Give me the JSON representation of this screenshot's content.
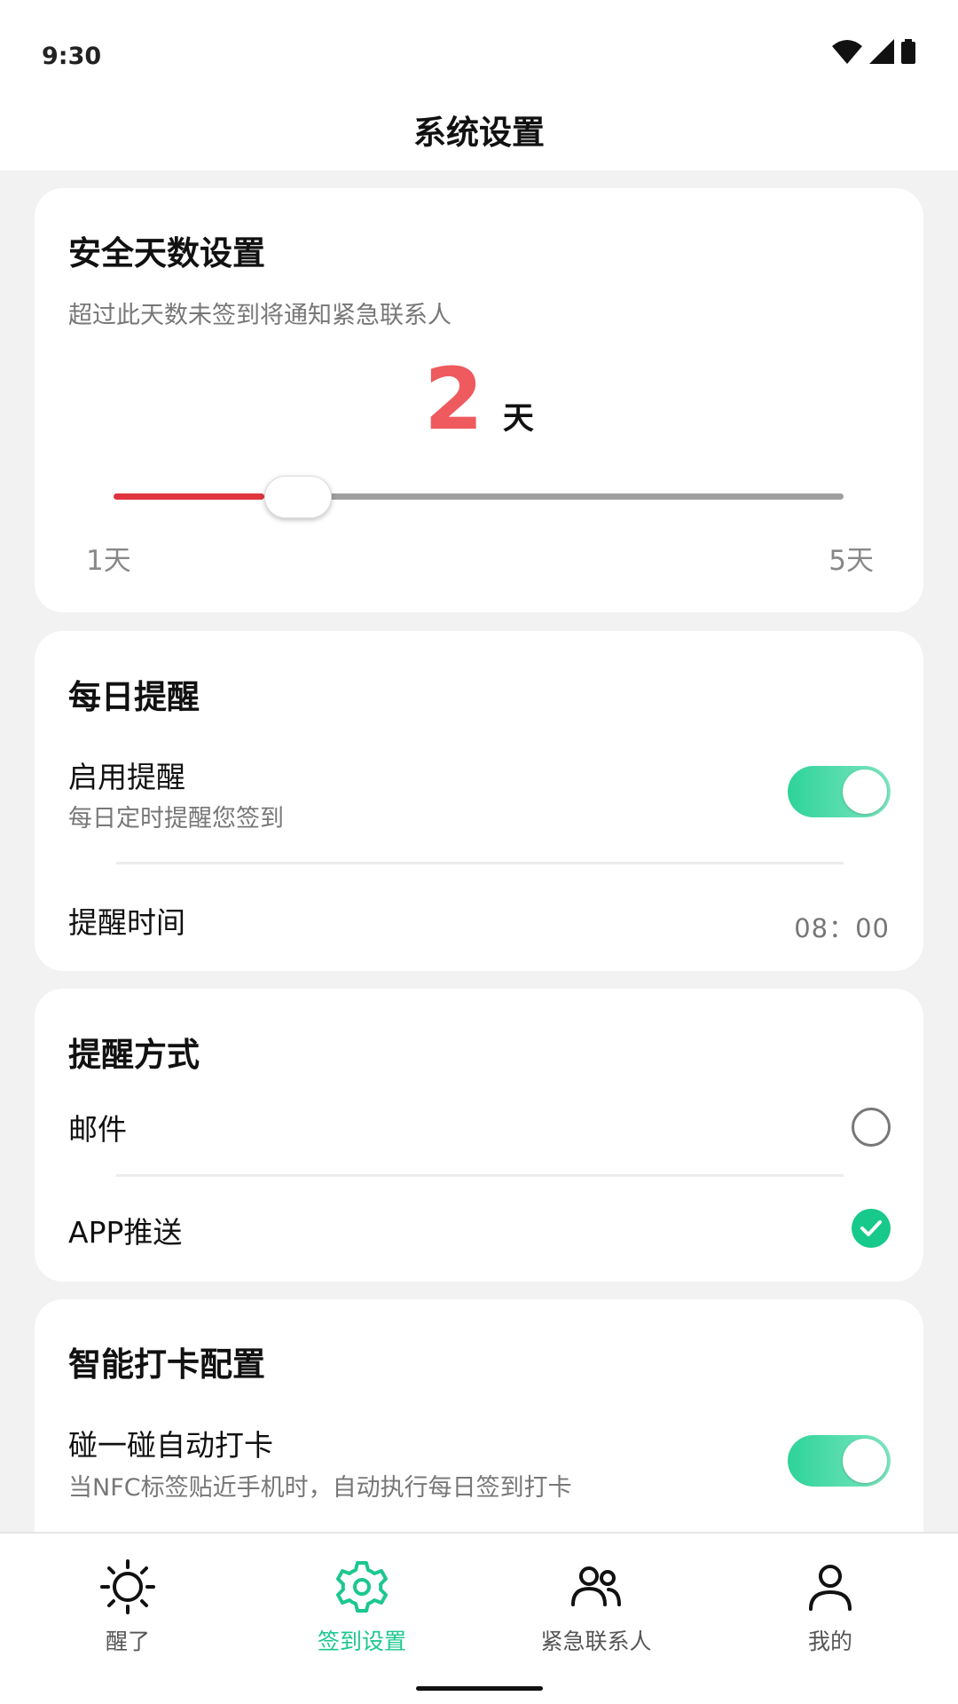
{
  "status": {
    "time": "9:30"
  },
  "header": {
    "title": "系统设置"
  },
  "safe_days": {
    "title": "安全天数设置",
    "description": "超过此天数未签到将通知紧急联系人",
    "value": "2",
    "unit": "天",
    "min_label": "1天",
    "max_label": "5天",
    "slider_fraction": 0.25,
    "accent": "#e0343e"
  },
  "daily_reminder": {
    "title": "每日提醒",
    "enable_label": "启用提醒",
    "enable_sub": "每日定时提醒您签到",
    "enabled": true,
    "time_label": "提醒时间",
    "time_value": "08：00"
  },
  "reminder_method": {
    "title": "提醒方式",
    "options": [
      {
        "label": "邮件",
        "selected": false
      },
      {
        "label": "APP推送",
        "selected": true
      }
    ]
  },
  "smart_checkin": {
    "title": "智能打卡配置",
    "nfc_label": "碰一碰自动打卡",
    "nfc_sub": "当NFC标签贴近手机时，自动执行每日签到打卡",
    "enabled": true
  },
  "nav": {
    "items": [
      {
        "label": "醒了",
        "icon": "sun-icon",
        "active": false
      },
      {
        "label": "签到设置",
        "icon": "gear-icon",
        "active": true
      },
      {
        "label": "紧急联系人",
        "icon": "contacts-icon",
        "active": false
      },
      {
        "label": "我的",
        "icon": "person-icon",
        "active": false
      }
    ]
  },
  "colors": {
    "accent_green": "#1cc78f",
    "accent_red": "#e0343e"
  }
}
